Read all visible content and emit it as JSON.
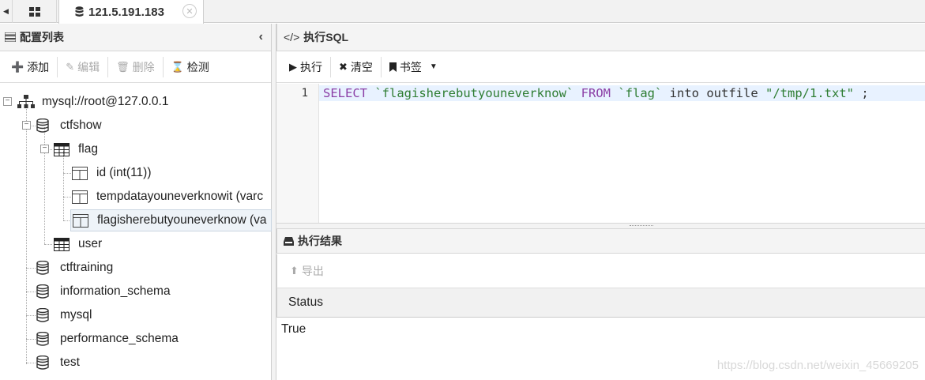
{
  "tabs": {
    "active_label": "121.5.191.183"
  },
  "left_panel": {
    "title": "配置列表",
    "toolbar": {
      "add": "添加",
      "edit": "编辑",
      "delete": "删除",
      "test": "检测"
    },
    "tree": {
      "connection": "mysql://root@127.0.0.1",
      "databases": [
        "ctfshow",
        "ctftraining",
        "information_schema",
        "mysql",
        "performance_schema",
        "test"
      ],
      "tables": [
        "flag",
        "user"
      ],
      "columns": [
        "id (int(11))",
        "tempdatayouneverknowit (varc",
        "flagisherebutyouneverknow (va"
      ]
    }
  },
  "sql_panel": {
    "title": "执行SQL",
    "toolbar": {
      "run": "执行",
      "clear": "清空",
      "bookmark": "书签"
    },
    "line_number": "1",
    "code": {
      "kw1": "SELECT",
      "col": "`flagisherebutyouneverknow`",
      "kw2": "FROM",
      "table": "`flag`",
      "rest": "into outfile",
      "path": "\"/tmp/1.txt\"",
      "end": ";"
    }
  },
  "result_panel": {
    "title": "执行结果",
    "export": "导出",
    "column_header": "Status",
    "value": "True"
  },
  "watermark": "https://blog.csdn.net/weixin_45669205"
}
